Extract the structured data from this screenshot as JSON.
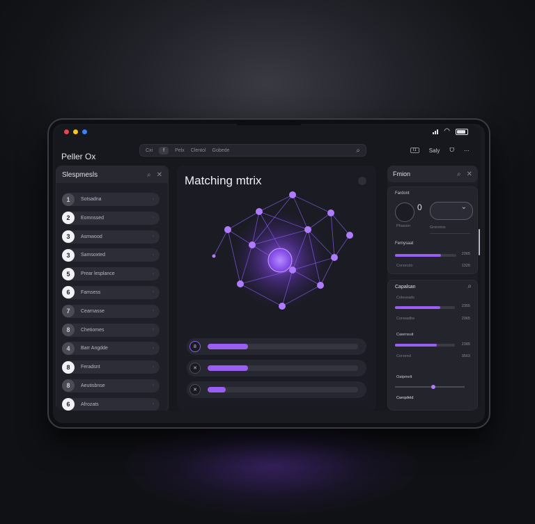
{
  "window": {
    "title": "Peller Ox",
    "traffic_lights": [
      "#e5484d",
      "#f5c518",
      "#3b82f6"
    ]
  },
  "url_bar": {
    "items": [
      "Cxi",
      "f",
      "Pelx",
      "Clentol",
      "Gobede"
    ],
    "search_icon": "search-icon"
  },
  "top_right": {
    "box_label": "I1",
    "user": "Saly",
    "toggle": "ᗜ",
    "more": "⋯"
  },
  "left_panel": {
    "title": "Slespmesls",
    "steps": [
      {
        "num": "1",
        "label": "Sotsadna",
        "highlight": false
      },
      {
        "num": "2",
        "label": "Eomnssed",
        "highlight": true
      },
      {
        "num": "3",
        "label": "Asmwood",
        "highlight": true
      },
      {
        "num": "3",
        "label": "Samsoxted",
        "highlight": true
      },
      {
        "num": "5",
        "label": "Prear lesplance",
        "highlight": true
      },
      {
        "num": "6",
        "label": "Famsess",
        "highlight": true
      },
      {
        "num": "7",
        "label": "Cearnasse",
        "highlight": false
      },
      {
        "num": "8",
        "label": "Chetiomes",
        "highlight": false
      },
      {
        "num": "4",
        "label": "Barr Angdde",
        "highlight": false
      },
      {
        "num": "8",
        "label": "Feradsnt",
        "highlight": true
      },
      {
        "num": "8",
        "label": "Aeutisbnse",
        "highlight": false
      },
      {
        "num": "6",
        "label": "Afrozats",
        "highlight": true
      }
    ]
  },
  "center_panel": {
    "title": "Matching mtrix",
    "sliders": [
      {
        "icon": "8",
        "fill": 0.27
      },
      {
        "icon": "✕",
        "fill": 0.27
      },
      {
        "icon": "✕",
        "fill": 0.12
      }
    ]
  },
  "right_panel": {
    "title": "Fmion",
    "card1": {
      "label": "Fardont",
      "zero": "0",
      "sub_left": "Phasion",
      "sub_right": "Gronntos",
      "section": "Femysaat",
      "fill": 0.75,
      "num1": "2365",
      "sub2": "Corsecdo",
      "num2": "1326"
    },
    "card2": {
      "title": "Capalsan",
      "row1_label": "Coleseads",
      "row1_fill": 0.75,
      "row1_num": "2355",
      "row1_sub": "Conwadbe",
      "row1_sub_num": "2365",
      "row2_label": "Cawrnsuit",
      "row2_fill": 0.7,
      "row2_num": "2385",
      "row2_sub": "Cersend",
      "row2_sub_num": "3563",
      "row3_label": "Oatpmelt",
      "row3_fill": 0.55,
      "footer": "Cwrqsfeld"
    }
  },
  "colors": {
    "accent": "#9a5ff2",
    "background": "#17181e"
  }
}
